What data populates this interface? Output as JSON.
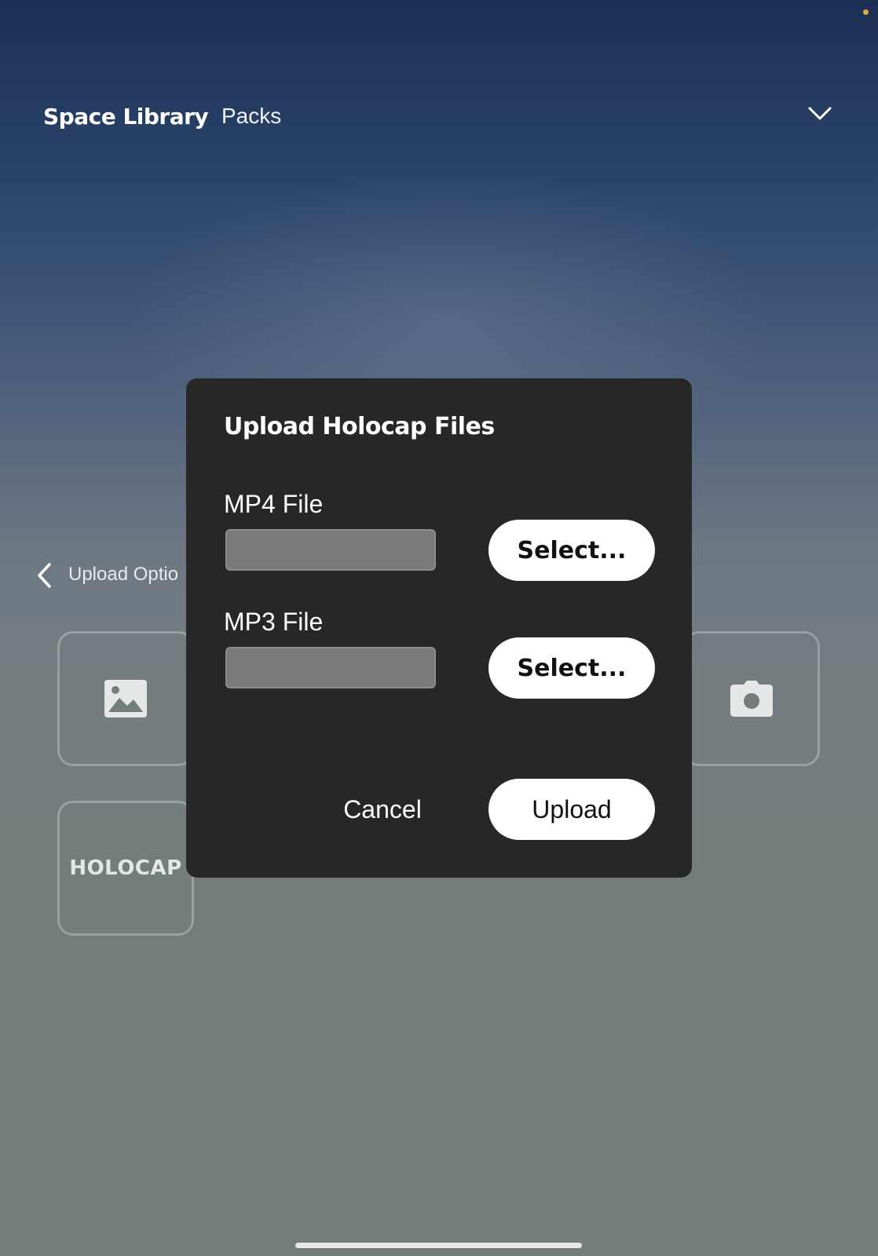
{
  "nav": {
    "title": "Space Library",
    "tab": "Packs"
  },
  "back": {
    "label": "Upload Optio"
  },
  "tiles": {
    "holocap_label": "HOLOCAP"
  },
  "modal": {
    "title": "Upload Holocap Files",
    "mp4": {
      "label": "MP4 File",
      "value": "",
      "button": "Select..."
    },
    "mp3": {
      "label": "MP3 File",
      "value": "",
      "button": "Select..."
    },
    "cancel": "Cancel",
    "upload": "Upload"
  },
  "colors": {
    "modal_bg": "#272727",
    "accent_dot": "#e8a83a"
  }
}
